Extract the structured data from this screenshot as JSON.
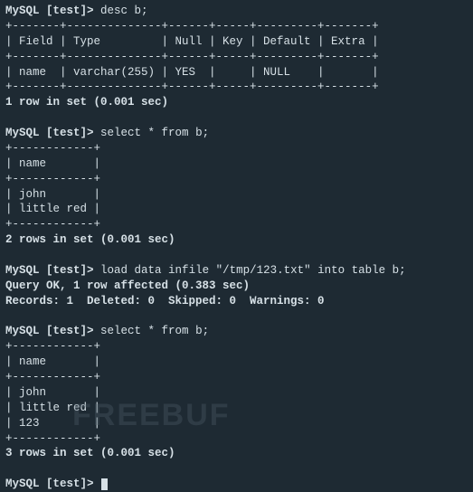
{
  "session": {
    "prompt": "MySQL [test]>",
    "cmd1": "desc b;",
    "cmd2": "select * from b;",
    "cmd3": "load data infile \"/tmp/123.txt\" into table b;",
    "cmd4": "select * from b;",
    "finalPrompt": "MySQL [test]>"
  },
  "descTable": {
    "border": "+-------+--------------+------+-----+---------+-------+",
    "header": "| Field | Type         | Null | Key | Default | Extra |",
    "row1": "| name  | varchar(255) | YES  |     | NULL    |       |",
    "result": "1 row in set (0.001 sec)"
  },
  "select1": {
    "border": "+------------+",
    "header": "| name       |",
    "row1": "| john       |",
    "row2": "| little red |",
    "result": "2 rows in set (0.001 sec)"
  },
  "loadResult": {
    "line1": "Query OK, 1 row affected (0.383 sec)",
    "line2": "Records: 1  Deleted: 0  Skipped: 0  Warnings: 0"
  },
  "select2": {
    "border": "+------------+",
    "header": "| name       |",
    "row1": "| john       |",
    "row2": "| little red |",
    "row3": "| 123        |",
    "result": "3 rows in set (0.001 sec)"
  },
  "watermark": "FREEBUF"
}
